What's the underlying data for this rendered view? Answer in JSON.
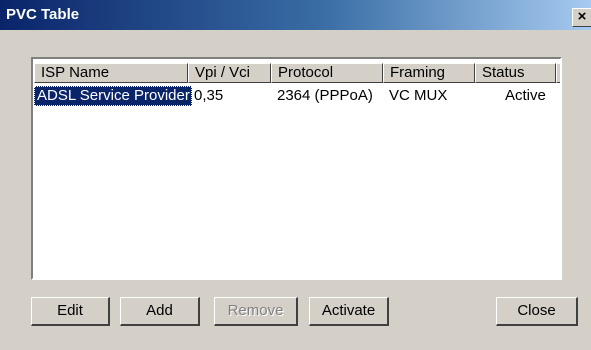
{
  "window": {
    "title": "PVC Table",
    "close_glyph": "×"
  },
  "table": {
    "columns": [
      "ISP Name",
      "Vpi / Vci",
      "Protocol",
      "Framing",
      "Status"
    ],
    "rows": [
      [
        "ADSL Service Provider",
        "0,35",
        "2364 (PPPoA)",
        "VC MUX",
        "Active"
      ]
    ]
  },
  "buttons": {
    "edit": "Edit",
    "add": "Add",
    "remove": "Remove",
    "activate": "Activate",
    "close": "Close"
  }
}
